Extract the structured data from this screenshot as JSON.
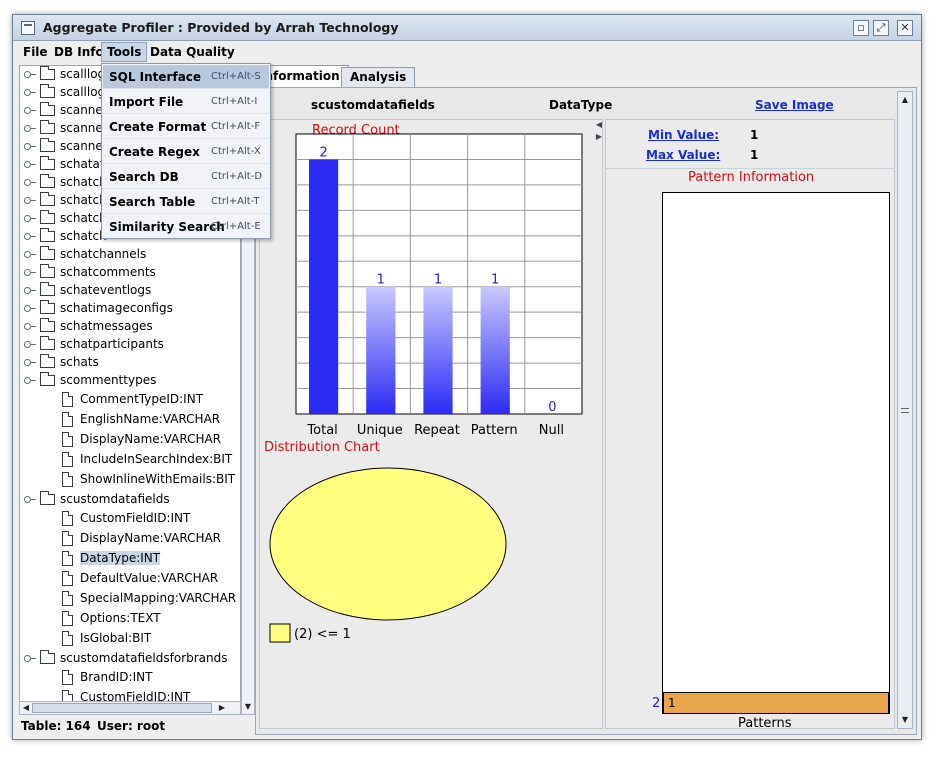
{
  "window": {
    "title": "Aggregate Profiler : Provided by Arrah Technology"
  },
  "menubar": [
    {
      "label": "File"
    },
    {
      "label": "DB Info"
    },
    {
      "label": "Tools"
    },
    {
      "label": "Data Quality"
    }
  ],
  "tools_menu": {
    "items": [
      {
        "label": "SQL Interface",
        "accel": "Ctrl+Alt-S"
      },
      {
        "label": "Import File",
        "accel": "Ctrl+Alt-I"
      },
      {
        "label": "Create Format",
        "accel": "Ctrl+Alt-F"
      },
      {
        "label": "Create Regex",
        "accel": "Ctrl+Alt-X"
      },
      {
        "label": "Search DB",
        "accel": "Ctrl+Alt-D"
      },
      {
        "label": "Search Table",
        "accel": "Ctrl+Alt-T"
      },
      {
        "label": "Similarity Search",
        "accel": "Ctrl+Alt-E"
      }
    ]
  },
  "tree": {
    "tables_top": [
      "scalllog",
      "scalllog",
      "scanne",
      "scanne",
      "scanne",
      "schatat",
      "schatch",
      "schatch",
      "schatch",
      "schatch",
      "schatchannels",
      "schatcomments",
      "schateventlogs",
      "schatimageconfigs",
      "schatmessages",
      "schatparticipants",
      "schats"
    ],
    "commenttypes": {
      "name": "scommenttypes",
      "columns": [
        "CommentTypeID:INT",
        "EnglishName:VARCHAR",
        "DisplayName:VARCHAR",
        "IncludeInSearchIndex:BIT",
        "ShowInlineWithEmails:BIT"
      ]
    },
    "customdatafields": {
      "name": "scustomdatafields",
      "columns": [
        "CustomFieldID:INT",
        "DisplayName:VARCHAR",
        "DataType:INT",
        "DefaultValue:VARCHAR",
        "SpecialMapping:VARCHAR",
        "Options:TEXT",
        "IsGlobal:BIT"
      ]
    },
    "customdatafieldsforbrands": {
      "name": "scustomdatafieldsforbrands",
      "columns": [
        "BrandID:INT",
        "CustomFieldID:INT"
      ]
    }
  },
  "status": {
    "table": "Table: 164",
    "user": "User: root"
  },
  "tabs": [
    {
      "label": "Information"
    },
    {
      "label": "Analysis"
    }
  ],
  "header": {
    "table_name": "scustomdatafields",
    "column_name": "DataType",
    "save_image": "Save Image"
  },
  "minmax": {
    "min_label": "Min Value:",
    "min_value": "1",
    "max_label": "Max Value:",
    "max_value": "1"
  },
  "pattern_info": {
    "title": "Pattern Information",
    "count_label": "2",
    "bar_label": "1",
    "x_label": "Patterns",
    "count": 2
  },
  "distribution": {
    "title": "Distribution Chart",
    "legend": "(2) <= 1"
  },
  "chart_data": [
    {
      "type": "bar",
      "title": "Record Count",
      "categories": [
        "Total",
        "Unique",
        "Repeat",
        "Pattern",
        "Null"
      ],
      "values": [
        2,
        1,
        1,
        1,
        0
      ],
      "ylim": [
        0,
        2.2
      ]
    },
    {
      "type": "pie",
      "title": "Distribution Chart",
      "categories": [
        "(2) <= 1"
      ],
      "values": [
        2
      ]
    }
  ],
  "colors": {
    "bar": "#2b2bf5",
    "pie": "#ffff80",
    "pattern_bar": "#e8a64a",
    "red_text": "#d01010",
    "link": "#1a2fd0"
  }
}
